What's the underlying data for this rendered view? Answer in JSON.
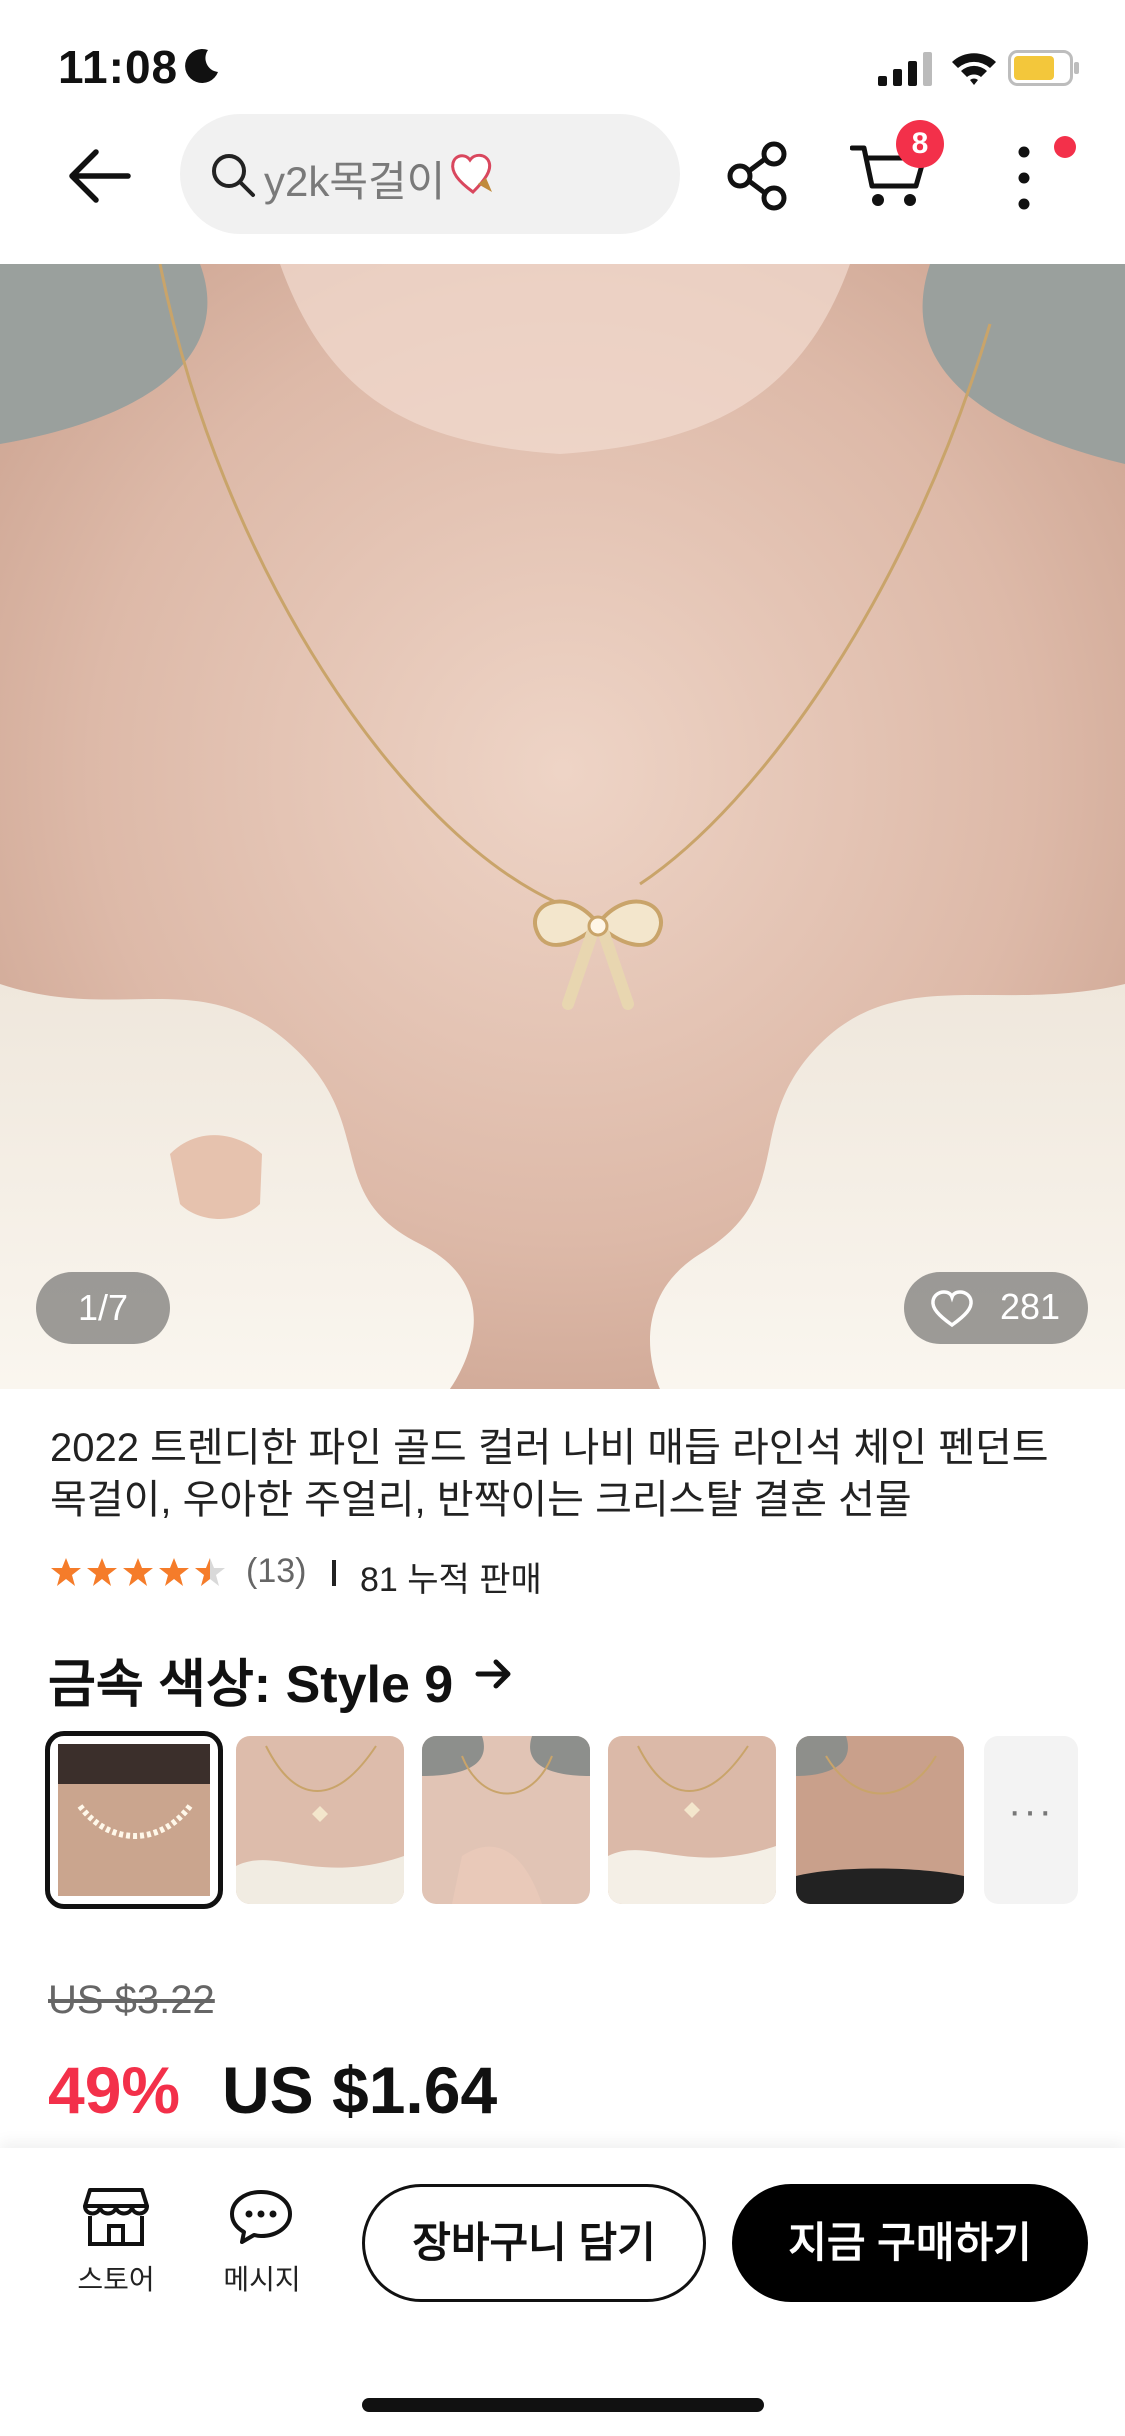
{
  "status_bar": {
    "time": "11:08",
    "icons": [
      "moon-icon",
      "cellular-signal-icon",
      "wifi-icon",
      "battery-icon"
    ]
  },
  "header": {
    "search_text": "y2k목걸이",
    "cart_count": "8",
    "icons": [
      "back-arrow-icon",
      "search-icon",
      "heart-sticker-icon",
      "share-icon",
      "cart-icon",
      "more-vertical-icon"
    ]
  },
  "gallery": {
    "page_indicator": "1/7",
    "wishlist_count": "281",
    "current_page": 1,
    "total_pages": 7
  },
  "product": {
    "title_line1": "2022 트렌디한 파인 골드 컬러 나비 매듭 라인석 체인 펜던트",
    "title_line2": "목걸이, 우아한 주얼리, 반짝이는 크리스탈 결혼 선물",
    "rating": 4.5,
    "rating_count": "(13)",
    "sold": "81 누적 판매"
  },
  "variant": {
    "label": "금속 색상: Style 9",
    "more": "···",
    "selected_index": 0
  },
  "price": {
    "original": "US $3.22",
    "discount": "49%",
    "current": "US $1.64"
  },
  "bottom_bar": {
    "store_label": "스토어",
    "message_label": "메시지",
    "add_to_cart": "장바구니 담기",
    "buy_now": "지금 구매하기"
  },
  "colors": {
    "accent_red": "#f3304a",
    "star_orange": "#f57c2a",
    "black": "#000000"
  }
}
